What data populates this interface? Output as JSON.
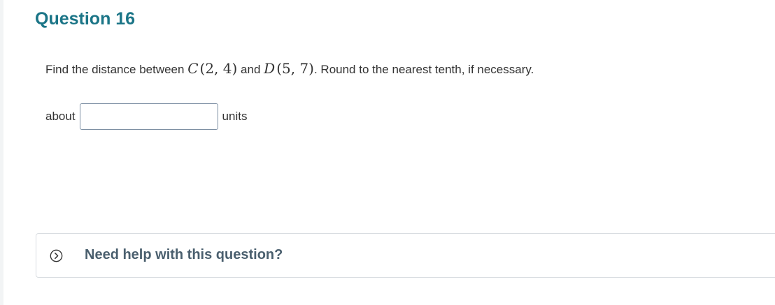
{
  "question": {
    "title": "Question 16",
    "prompt_prefix": "Find the distance between",
    "point1_name": "C",
    "point1_coords": "(2, 4)",
    "conjunction": "and",
    "point2_name": "D",
    "point2_coords": "(5, 7)",
    "prompt_suffix": ". Round to the nearest tenth, if necessary."
  },
  "answer": {
    "prefix_label": "about",
    "value": "",
    "suffix_label": "units"
  },
  "help": {
    "label": "Need help with this question?",
    "icon": "chevron-right-circle-icon"
  },
  "colors": {
    "title": "#1b7587",
    "help_text": "#4a5f6e",
    "input_border": "#7d8fa3"
  }
}
